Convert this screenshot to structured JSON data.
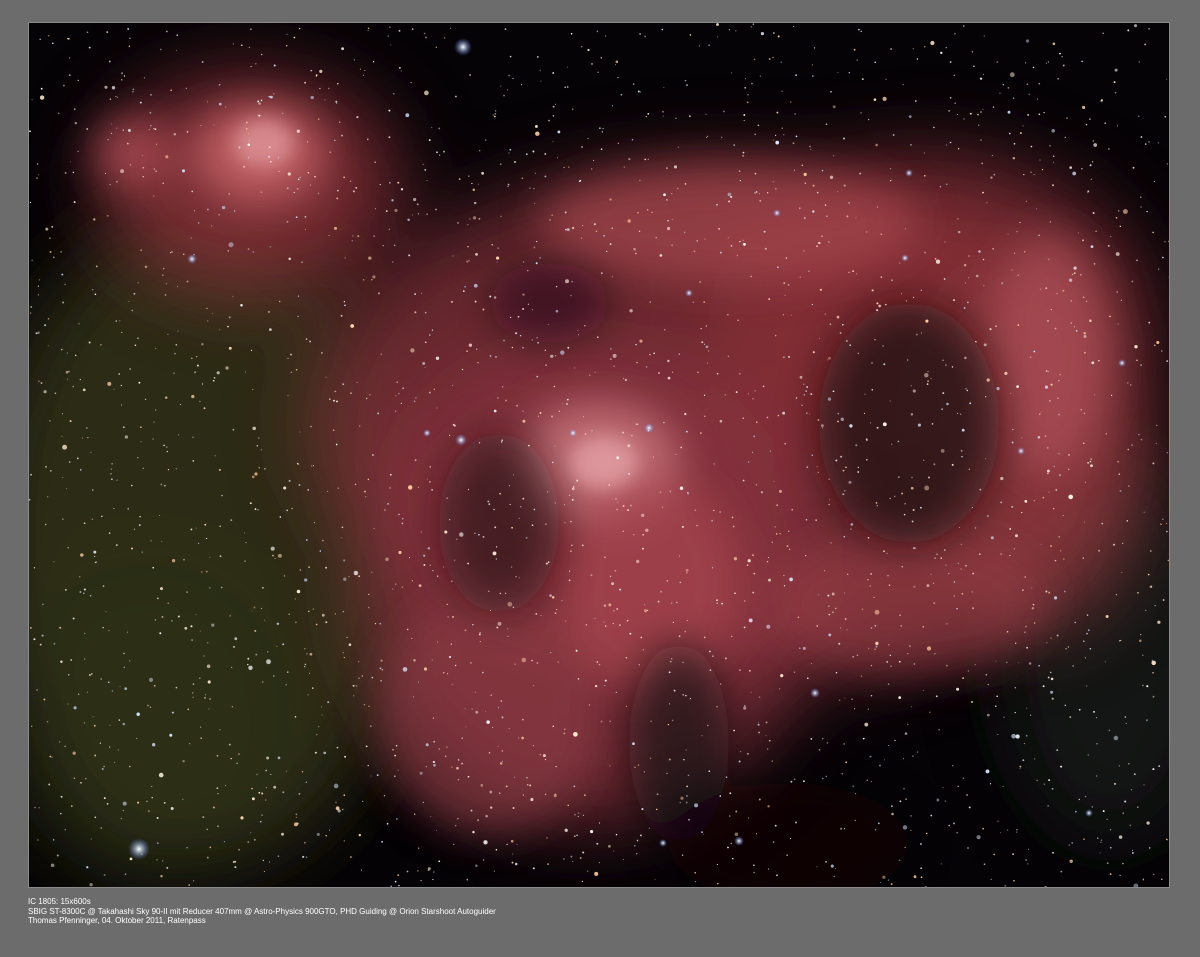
{
  "caption": {
    "line1": "IC 1805: 15x600s",
    "line2": "SBIG ST-8300C @ Takahashi Sky 90-II mit Reducer 407mm @ Astro-Physics 900GTO, PHD Guiding @ Orion Starshoot Autoguider",
    "line3": "Thomas Pfenninger, 04. Oktober 2011, Ratenpass"
  },
  "colors": {
    "frame": "#6c6c6c",
    "sky": "#050306",
    "nebula": "#b8505a",
    "nebula_core": "#d88a8e",
    "milky_way": "#3a3a1e"
  },
  "icons": [
    "nebula-photo"
  ]
}
